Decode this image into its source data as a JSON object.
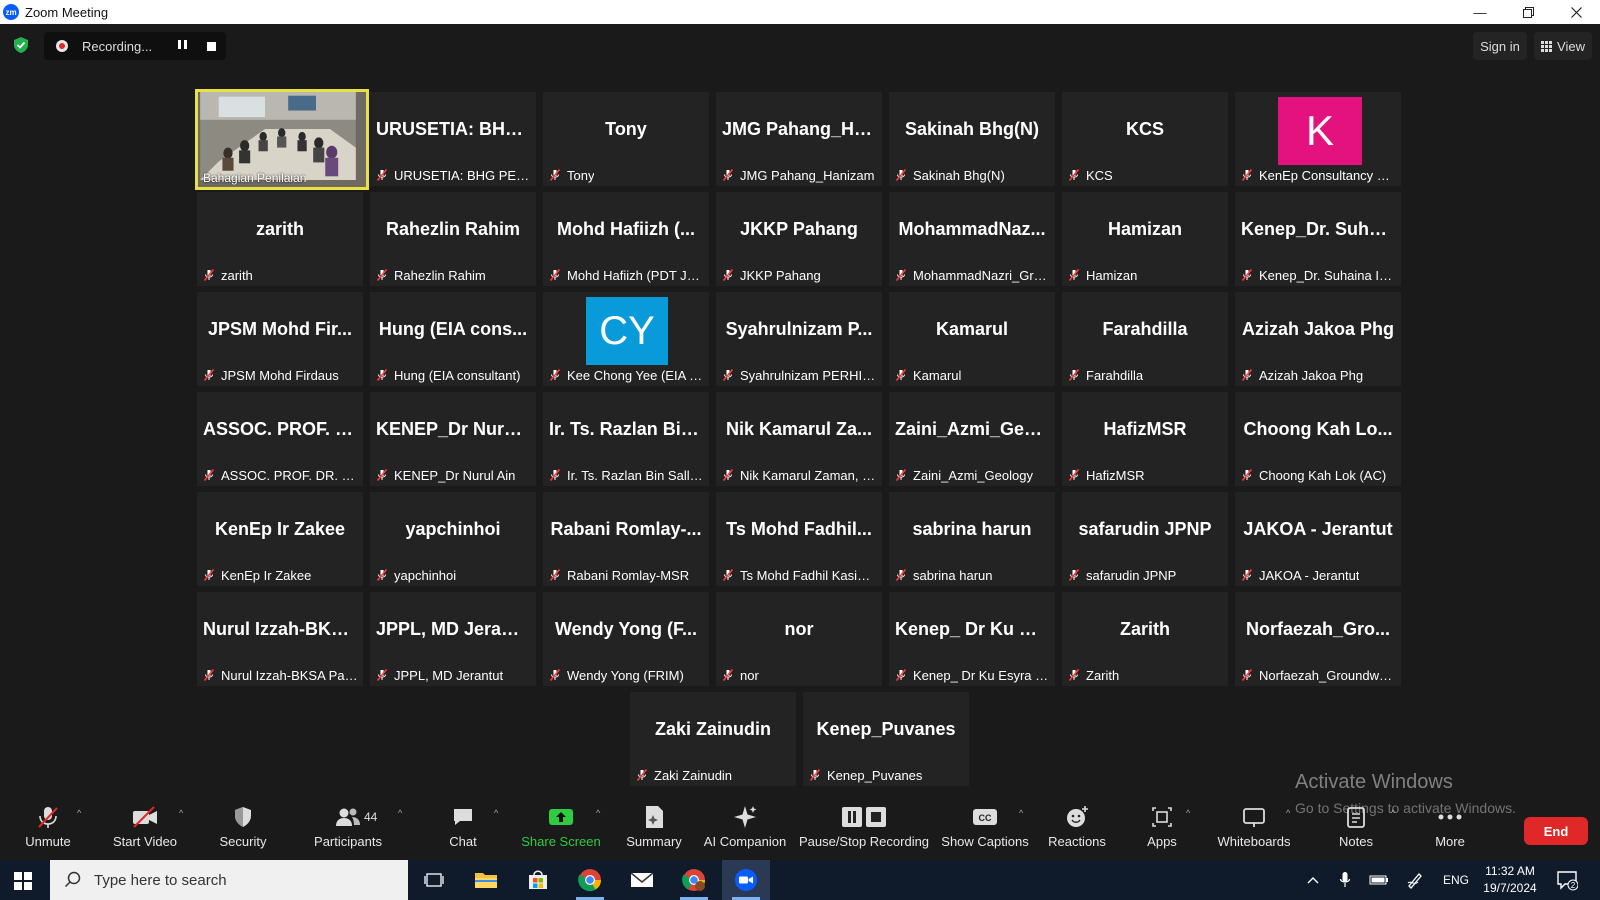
{
  "window": {
    "title": "Zoom Meeting",
    "app_icon": "zm",
    "controls": [
      "minimize-icon",
      "restore-icon",
      "close-icon"
    ]
  },
  "topbar": {
    "recording_text": "Recording...",
    "sign_in": "Sign in",
    "view": "View"
  },
  "tiles": [
    {
      "big": "",
      "name": "Bahagian Penilaian",
      "video": true,
      "active": true
    },
    {
      "big": "URUSETIA: BHG...",
      "name": "URUSETIA: BHG PENIL..."
    },
    {
      "big": "Tony",
      "name": "Tony"
    },
    {
      "big": "JMG Pahang_Ha...",
      "name": "JMG Pahang_Hanizam"
    },
    {
      "big": "Sakinah Bhg(N)",
      "name": "Sakinah Bhg(N)"
    },
    {
      "big": "KCS",
      "name": "KCS"
    },
    {
      "big": "",
      "name": "KenEp Consultancy & ...",
      "avatar": "K",
      "avatar_color": "#e3127e"
    },
    {
      "big": "zarith",
      "name": "zarith"
    },
    {
      "big": "Rahezlin Rahim",
      "name": "Rahezlin Rahim"
    },
    {
      "big": "Mohd Hafiizh (...",
      "name": "Mohd Hafiizh (PDT Jer..."
    },
    {
      "big": "JKKP Pahang",
      "name": "JKKP Pahang"
    },
    {
      "big": "MohammadNaz...",
      "name": "MohammadNazri_Gro..."
    },
    {
      "big": "Hamizan",
      "name": "Hamizan"
    },
    {
      "big": "Kenep_Dr. Suhai...",
      "name": "Kenep_Dr. Suhaina Ism..."
    },
    {
      "big": "JPSM Mohd Fir...",
      "name": "JPSM Mohd Firdaus"
    },
    {
      "big": "Hung (EIA cons...",
      "name": "Hung (EIA consultant)"
    },
    {
      "big": "",
      "name": "Kee Chong Yee (EIA Co...",
      "avatar": "CY",
      "avatar_color": "#099bd9"
    },
    {
      "big": "Syahrulnizam P...",
      "name": "Syahrulnizam PERHILI..."
    },
    {
      "big": "Kamarul",
      "name": "Kamarul"
    },
    {
      "big": "Farahdilla",
      "name": "Farahdilla"
    },
    {
      "big": "Azizah Jakoa Phg",
      "name": "Azizah Jakoa Phg"
    },
    {
      "big": "ASSOC. PROF. D...",
      "name": "ASSOC. PROF. DR. HA..."
    },
    {
      "big": "KENEP_Dr Nurul...",
      "name": "KENEP_Dr Nurul Ain"
    },
    {
      "big": "Ir. Ts. Razlan Bin...",
      "name": "Ir. Ts. Razlan Bin Salleh..."
    },
    {
      "big": "Nik Kamarul Za...",
      "name": "Nik Kamarul Zaman, P..."
    },
    {
      "big": "Zaini_Azmi_Geo...",
      "name": "Zaini_Azmi_Geology"
    },
    {
      "big": "HafizMSR",
      "name": "HafizMSR"
    },
    {
      "big": "Choong Kah Lo...",
      "name": "Choong Kah Lok (AC)"
    },
    {
      "big": "KenEp Ir Zakee",
      "name": "KenEp Ir Zakee"
    },
    {
      "big": "yapchinhoi",
      "name": "yapchinhoi"
    },
    {
      "big": "Rabani Romlay-...",
      "name": "Rabani Romlay-MSR"
    },
    {
      "big": "Ts Mohd Fadhil...",
      "name": "Ts Mohd Fadhil Kasim (..."
    },
    {
      "big": "sabrina harun",
      "name": "sabrina harun"
    },
    {
      "big": "safarudin JPNP",
      "name": "safarudin JPNP"
    },
    {
      "big": "JAKOA - Jerantut",
      "name": "JAKOA - Jerantut"
    },
    {
      "big": "Nurul Izzah-BKS...",
      "name": "Nurul Izzah-BKSA Paha..."
    },
    {
      "big": "JPPL, MD Jerant...",
      "name": "JPPL, MD Jerantut"
    },
    {
      "big": "Wendy Yong (F...",
      "name": "Wendy Yong (FRIM)"
    },
    {
      "big": "nor",
      "name": "nor"
    },
    {
      "big": "Kenep_ Dr Ku Es...",
      "name": "Kenep_ Dr Ku Esyra Ha..."
    },
    {
      "big": "Zarith",
      "name": "Zarith"
    },
    {
      "big": "Norfaezah_Gro...",
      "name": "Norfaezah_Groundwat..."
    },
    {
      "big": "Zaki Zainudin",
      "name": "Zaki Zainudin"
    },
    {
      "big": "Kenep_Puvanes",
      "name": "Kenep_Puvanes"
    }
  ],
  "watermark": {
    "line1": "Activate Windows",
    "line2": "Go to Settings to activate Windows."
  },
  "toolbar": {
    "unmute": "Unmute",
    "start_video": "Start Video",
    "security": "Security",
    "participants": "Participants",
    "participant_count": "44",
    "chat": "Chat",
    "share_screen": "Share Screen",
    "summary": "Summary",
    "ai_companion": "AI Companion",
    "pause_stop_recording": "Pause/Stop Recording",
    "show_captions": "Show Captions",
    "reactions": "Reactions",
    "apps": "Apps",
    "whiteboards": "Whiteboards",
    "notes": "Notes",
    "more": "More",
    "end": "End",
    "share_color": "#2ecc40",
    "end_color": "#e02828"
  },
  "taskbar": {
    "search_placeholder": "Type here to search",
    "language": "ENG",
    "time": "11:32 AM",
    "date": "19/7/2024",
    "notification_count": "2"
  }
}
